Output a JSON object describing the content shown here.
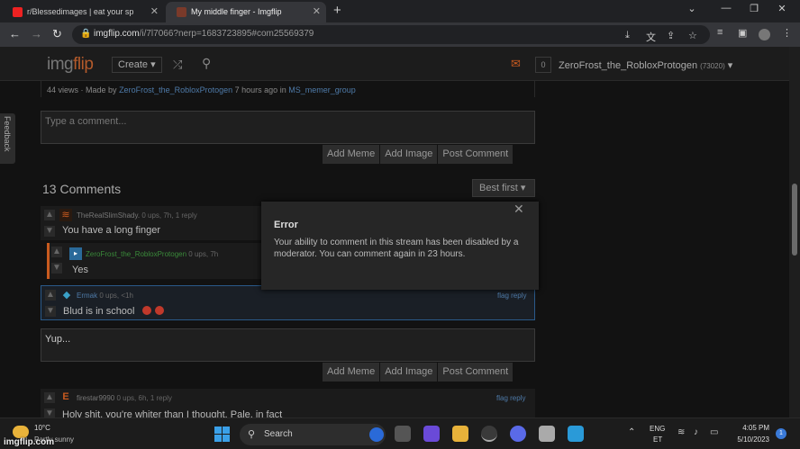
{
  "browser": {
    "tab1_title": "r/Blessedimages | eat your sp",
    "tab2_title": "My middle finger - Imgflip",
    "url_host": "imgflip.com",
    "url_path": "/i/7l7066?nerp=1683723895#com25569379"
  },
  "site": {
    "logo_a": "img",
    "logo_b": "flip",
    "create_label": "Create",
    "notif_count": "0",
    "username": "ZeroFrost_the_RobloxProtogen",
    "user_points": "(73020)"
  },
  "feedback_label": "Feedback",
  "meta": {
    "views": "44 views · Made by",
    "author": "ZeroFrost_the_RobloxProtogen",
    "time": "7 hours ago in",
    "stream": "MS_memer_group"
  },
  "comment_box_1": {
    "placeholder": "Type a comment..."
  },
  "buttons": {
    "add_meme": "Add Meme",
    "add_image": "Add Image",
    "post_comment": "Post Comment"
  },
  "comments_header": {
    "count": "13 Comments",
    "sort": "Best first"
  },
  "comments": [
    {
      "user": "TheRealSlimShady.",
      "stats": "0 ups, 7h, 1 reply",
      "text": "You have a long finger",
      "actions": "reply"
    },
    {
      "user": "ZeroFrost_the_RobloxProtogen",
      "stats": "0 ups, 7h",
      "text": "Yes",
      "actions": "reply"
    },
    {
      "user": "Ermak",
      "stats": "0 ups, <1h",
      "text": "Blud is in school",
      "actions": "flag  reply"
    },
    {
      "user": "firestar9990",
      "stats": "0 ups, 6h, 1 reply",
      "text": "Holy shit, you're whiter than I thought. Pale, in fact",
      "actions": "flag  reply"
    }
  ],
  "comment_box_2": {
    "value": "Yup..."
  },
  "modal": {
    "title": "Error",
    "message": "Your ability to comment in this stream has been disabled by a moderator. You can comment again in 23 hours.",
    "close": "✕"
  },
  "taskbar": {
    "temp": "10°C",
    "condition": "Partly sunny",
    "search_label": "Search",
    "lang": "ENG",
    "region": "ET",
    "time": "4:05 PM",
    "date": "5/10/2023",
    "notif": "1"
  },
  "watermark": "imgflip.com",
  "colors": {
    "accent_orange": "#c85a1f",
    "link_blue": "#4e7aa8",
    "bg": "#121212"
  }
}
